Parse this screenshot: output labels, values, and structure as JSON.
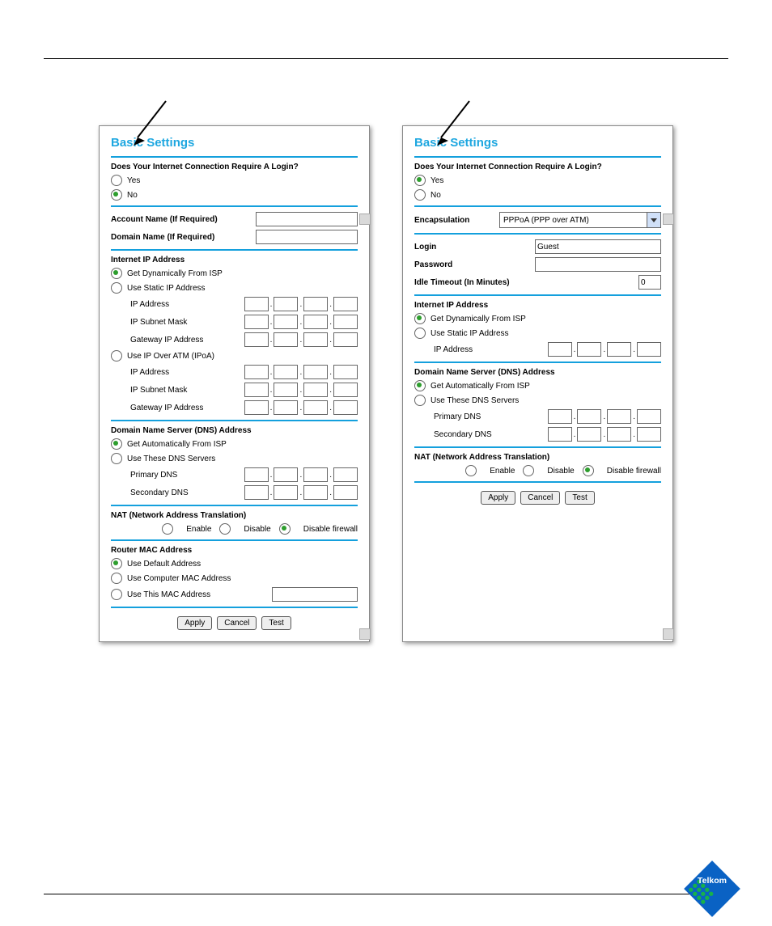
{
  "left": {
    "title": "Basic Settings",
    "q": "Does Your Internet Connection Require A Login?",
    "yes": "Yes",
    "no": "No",
    "accountName": "Account Name  (If Required)",
    "domainName": "Domain Name  (If Required)",
    "iipHeader": "Internet IP Address",
    "getDyn": "Get Dynamically From ISP",
    "useStatic": "Use Static IP Address",
    "ipAddress": "IP Address",
    "ipSubnet": "IP Subnet Mask",
    "gatewayIp": "Gateway IP Address",
    "useIpoa": "Use IP Over ATM (IPoA)",
    "dnsHeader": "Domain Name Server (DNS) Address",
    "getAuto": "Get Automatically From ISP",
    "useThese": "Use These DNS Servers",
    "primaryDns": "Primary DNS",
    "secondaryDns": "Secondary DNS",
    "natHeader": "NAT (Network Address Translation)",
    "enable": "Enable",
    "disable": "Disable",
    "disableFw": "Disable firewall",
    "macHeader": "Router MAC Address",
    "useDefault": "Use Default Address",
    "useComputer": "Use Computer MAC Address",
    "useThisMac": "Use This MAC Address",
    "apply": "Apply",
    "cancel": "Cancel",
    "test": "Test"
  },
  "right": {
    "title": "Basic Settings",
    "q": "Does Your Internet Connection Require A Login?",
    "yes": "Yes",
    "no": "No",
    "encap": "Encapsulation",
    "encapValue": "PPPoA (PPP over ATM)",
    "login": "Login",
    "loginValue": "Guest",
    "password": "Password",
    "idle": "Idle Timeout (In Minutes)",
    "idleValue": "0",
    "iipHeader": "Internet IP Address",
    "getDyn": "Get Dynamically From ISP",
    "useStatic": "Use Static IP Address",
    "ipAddress": "IP Address",
    "dnsHeader": "Domain Name Server (DNS) Address",
    "getAuto": "Get Automatically From ISP",
    "useThese": "Use These DNS Servers",
    "primaryDns": "Primary DNS",
    "secondaryDns": "Secondary DNS",
    "natHeader": "NAT (Network Address Translation)",
    "enable": "Enable",
    "disable": "Disable",
    "disableFw": "Disable firewall",
    "apply": "Apply",
    "cancel": "Cancel",
    "test": "Test"
  },
  "logoText": "Telkom"
}
